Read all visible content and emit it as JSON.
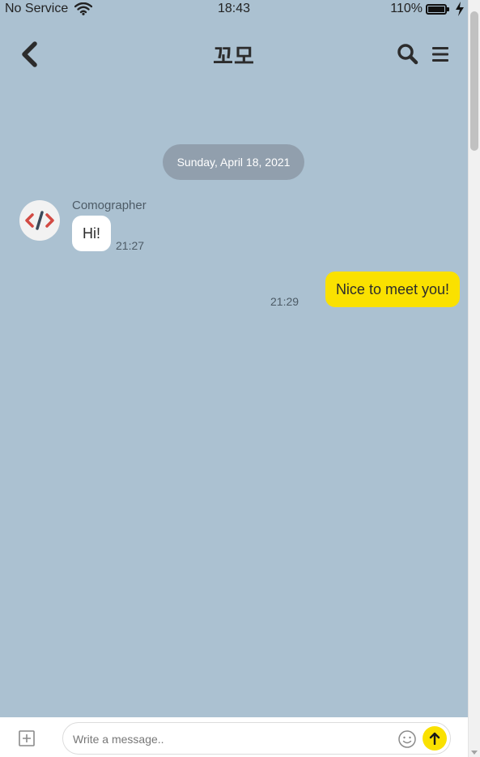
{
  "status_bar": {
    "carrier": "No Service",
    "time": "18:43",
    "battery": "110%"
  },
  "header": {
    "title": "꼬모"
  },
  "chat": {
    "date_separator": "Sunday, April 18, 2021",
    "messages": [
      {
        "direction": "incoming",
        "sender": "Comographer",
        "text": "Hi!",
        "time": "21:27"
      },
      {
        "direction": "outgoing",
        "text": "Nice to meet you!",
        "time": "21:29"
      }
    ]
  },
  "input_bar": {
    "placeholder": "Write a message..",
    "value": ""
  },
  "colors": {
    "background": "#abc1d1",
    "outgoing_bubble": "#fae100",
    "incoming_bubble": "#ffffff",
    "send_button": "#fae100"
  },
  "icons": [
    "back-chevron-icon",
    "search-icon",
    "menu-icon",
    "code-logo-icon",
    "attach-plus-icon",
    "emoji-icon",
    "send-arrow-icon",
    "wifi-icon",
    "battery-icon",
    "charging-icon"
  ]
}
